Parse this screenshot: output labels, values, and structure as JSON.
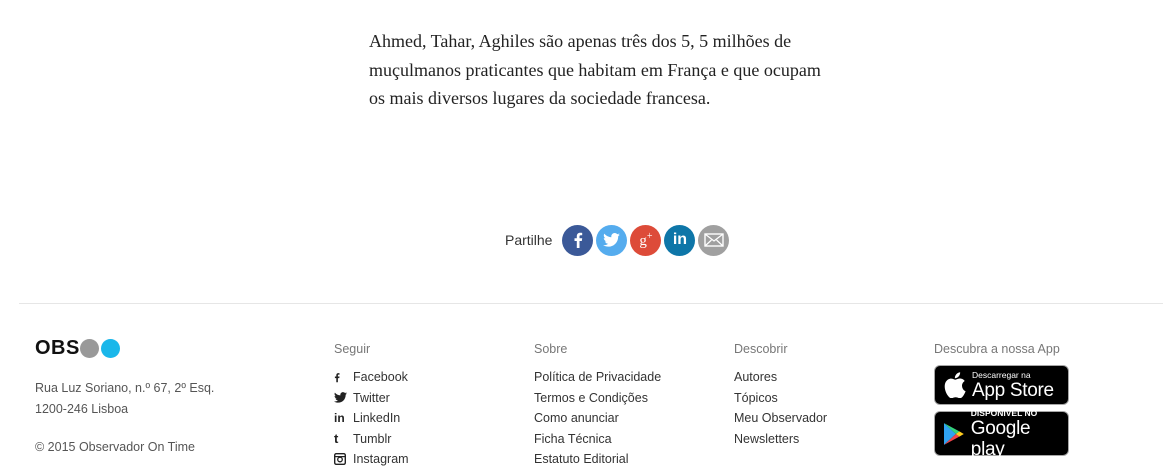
{
  "article": {
    "paragraph": "Ahmed, Tahar, Aghiles são apenas três dos 5, 5 milhões de muçulmanos praticantes que habitam em França e que ocupam os mais diversos lugares da sociedade francesa."
  },
  "share": {
    "label": "Partilhe",
    "buttons": [
      {
        "name": "facebook",
        "icon": "facebook-icon",
        "color": "#3b5998"
      },
      {
        "name": "twitter",
        "icon": "twitter-icon",
        "color": "#55acee"
      },
      {
        "name": "google-plus",
        "icon": "google-plus-icon",
        "color": "#dd4b39"
      },
      {
        "name": "linkedin",
        "icon": "linkedin-icon",
        "color": "#0e76a8"
      },
      {
        "name": "email",
        "icon": "email-icon",
        "color": "#a0a0a0"
      }
    ]
  },
  "footer": {
    "logo": {
      "text": "OBS",
      "dot_colors": [
        "#999999",
        "#1ab7ea"
      ]
    },
    "address_line1": "Rua Luz Soriano, n.º 67, 2º Esq.",
    "address_line2": "1200-246 Lisboa",
    "copyright": "© 2015 Observador On Time",
    "follow": {
      "title": "Seguir",
      "items": [
        {
          "label": "Facebook",
          "icon": "facebook-icon"
        },
        {
          "label": "Twitter",
          "icon": "twitter-icon"
        },
        {
          "label": "LinkedIn",
          "icon": "linkedin-icon"
        },
        {
          "label": "Tumblr",
          "icon": "tumblr-icon"
        },
        {
          "label": "Instagram",
          "icon": "instagram-icon"
        }
      ]
    },
    "about": {
      "title": "Sobre",
      "items": [
        "Política de Privacidade",
        "Termos e Condições",
        "Como anunciar",
        "Ficha Técnica",
        "Estatuto Editorial"
      ]
    },
    "discover": {
      "title": "Descobrir",
      "items": [
        "Autores",
        "Tópicos",
        "Meu Observador",
        "Newsletters"
      ]
    },
    "app": {
      "title": "Descubra a nossa App",
      "appstore_small": "Descarregar na",
      "appstore_big": "App Store",
      "googleplay_small": "DISPONÍVEL NO",
      "googleplay_big": "Google play"
    }
  }
}
